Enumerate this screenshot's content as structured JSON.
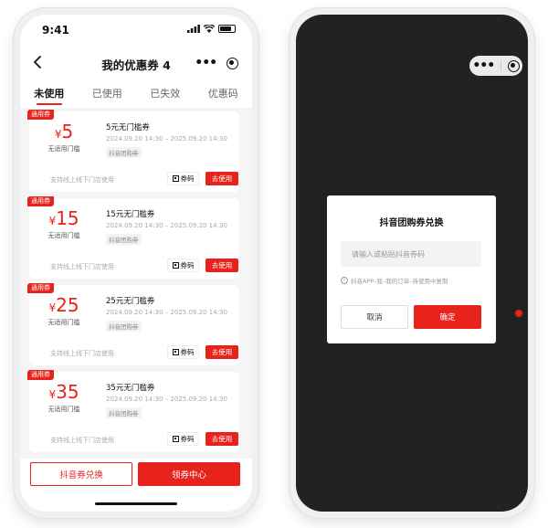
{
  "colors": {
    "accent": "#e8231c",
    "dark_screen": "#222222",
    "page_bg": "#f5f5f5"
  },
  "status_bar": {
    "time": "9:41"
  },
  "header": {
    "title": "我的优惠券 4",
    "more_icon": "more-dots-icon",
    "close_icon": "target-icon"
  },
  "tabs": [
    {
      "label": "未使用",
      "active": true
    },
    {
      "label": "已使用",
      "active": false
    },
    {
      "label": "已失效",
      "active": false
    },
    {
      "label": "优惠码",
      "active": false
    }
  ],
  "coupons": [
    {
      "tag": "通用券",
      "currency": "¥",
      "amount": "5",
      "threshold": "无适用门槛",
      "title": "5元无门槛券",
      "date": "2024.09.20 14:30 – 2025.09.20 14:30",
      "label": "抖音团购券",
      "desc": "支持线上线下门店使用",
      "code_btn": "券码",
      "use_btn": "去使用"
    },
    {
      "tag": "通用券",
      "currency": "¥",
      "amount": "15",
      "threshold": "无适用门槛",
      "title": "15元无门槛券",
      "date": "2024.09.20 14:30 – 2025.09.20 14:30",
      "label": "抖音团购券",
      "desc": "支持线上线下门店使用",
      "code_btn": "券码",
      "use_btn": "去使用"
    },
    {
      "tag": "通用券",
      "currency": "¥",
      "amount": "25",
      "threshold": "无适用门槛",
      "title": "25元无门槛券",
      "date": "2024.09.20 14:30 – 2025.09.20 14:30",
      "label": "抖音团购券",
      "desc": "支持线上线下门店使用",
      "code_btn": "券码",
      "use_btn": "去使用"
    },
    {
      "tag": "通用券",
      "currency": "¥",
      "amount": "35",
      "threshold": "无适用门槛",
      "title": "35元无门槛券",
      "date": "2024.09.20 14:30 – 2025.09.20 14:30",
      "label": "抖音团购券",
      "desc": "支持线上线下门店使用",
      "code_btn": "券码",
      "use_btn": "去使用"
    }
  ],
  "bottom": {
    "redeem_label": "抖音券兑换",
    "center_label": "领券中心"
  },
  "modal": {
    "title": "抖音团购券兑换",
    "input_placeholder": "请输入或粘贴抖音券码",
    "input_value": "",
    "hint": "抖音APP–我–我的订单–待使用中复制",
    "cancel_label": "取消",
    "confirm_label": "确定"
  }
}
